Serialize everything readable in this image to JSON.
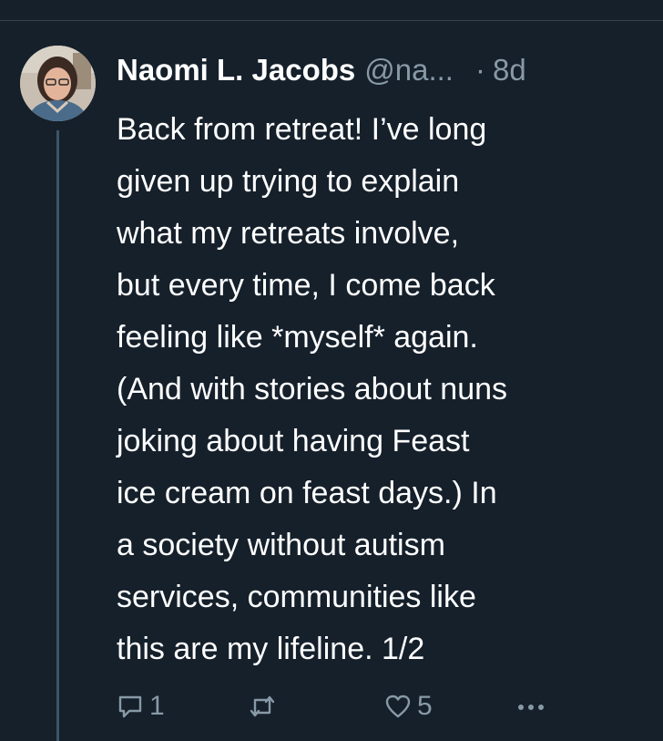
{
  "tweet": {
    "author": {
      "display_name": "Naomi L. Jacobs",
      "handle": "@na...",
      "avatar": "profile-photo"
    },
    "separator": "·",
    "timestamp": "8d",
    "lines": [
      "Back from retreat! I’ve long",
      "given up trying to explain",
      "what my retreats involve,",
      "but every time, I come back",
      "feeling like *myself* again.",
      "(And with stories about nuns",
      "joking about having Feast",
      "ice cream on feast days.) In",
      "a society without autism",
      "services, communities like",
      "this are my lifeline. 1/2"
    ],
    "actions": {
      "reply": {
        "icon": "reply-bubble-icon",
        "count": "1"
      },
      "retweet": {
        "icon": "retweet-icon",
        "count": ""
      },
      "like": {
        "icon": "heart-icon",
        "count": "5"
      },
      "more": {
        "icon": "more-dots-icon"
      }
    }
  },
  "colors": {
    "background": "#15202b",
    "text_primary": "#ffffff",
    "text_secondary": "#8899a6",
    "thread_line": "#3d5466",
    "divider": "#38444d"
  }
}
